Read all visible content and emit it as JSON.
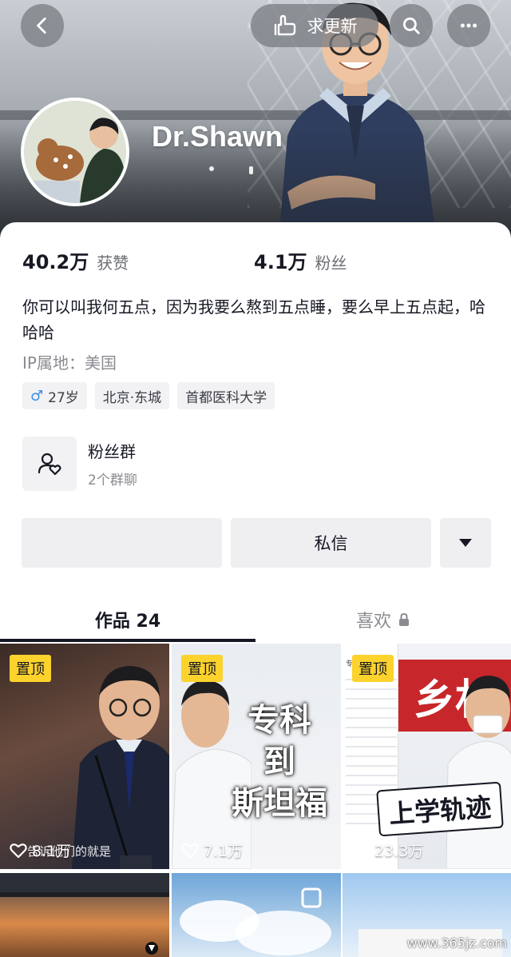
{
  "header": {
    "back_icon": "chevron-left-icon",
    "update_request_label": "求更新",
    "update_request_icon": "hand-point-icon",
    "search_icon": "search-icon",
    "more_icon": "more-dots-icon",
    "username": "Dr.Shawn"
  },
  "stats": {
    "likes_count": "40.2万",
    "likes_label": "获赞",
    "fans_count": "4.1万",
    "fans_label": "粉丝"
  },
  "bio": {
    "text": "你可以叫我何五点，因为我要么熬到五点睡，要么早上五点起，哈哈哈",
    "ip_location": "IP属地：美国"
  },
  "tags": [
    {
      "icon": "male-symbol-icon",
      "label": "27岁"
    },
    {
      "label": "北京·东城"
    },
    {
      "label": "首都医科大学"
    }
  ],
  "fan_group": {
    "title": "粉丝群",
    "subtitle": "2个群聊",
    "icon": "user-heart-icon"
  },
  "actions": {
    "follow_label": "",
    "message_label": "私信",
    "dropdown_icon": "triangle-down-icon"
  },
  "tabs": [
    {
      "label": "作品 24",
      "active": true
    },
    {
      "label": "喜欢",
      "icon": "lock-icon",
      "active": false
    }
  ],
  "videos": [
    {
      "pinned_label": "置顶",
      "likes": "8.1万",
      "caption": "告诉他们的就是"
    },
    {
      "pinned_label": "置顶",
      "likes": "7.1万",
      "title": "专科\n到\n斯坦福"
    },
    {
      "pinned_label": "置顶",
      "likes": "23.3万",
      "title": "上学轨迹",
      "banner_text": "乡村",
      "phone_text": "专科学校"
    },
    {},
    {},
    {}
  ],
  "watermark": "www.365jz.com",
  "colors": {
    "pin_badge": "#fcd22d",
    "text_primary": "#161823",
    "text_secondary": "#8a8b91",
    "button_bg": "#efeff1",
    "male_icon": "#3d8de0"
  }
}
